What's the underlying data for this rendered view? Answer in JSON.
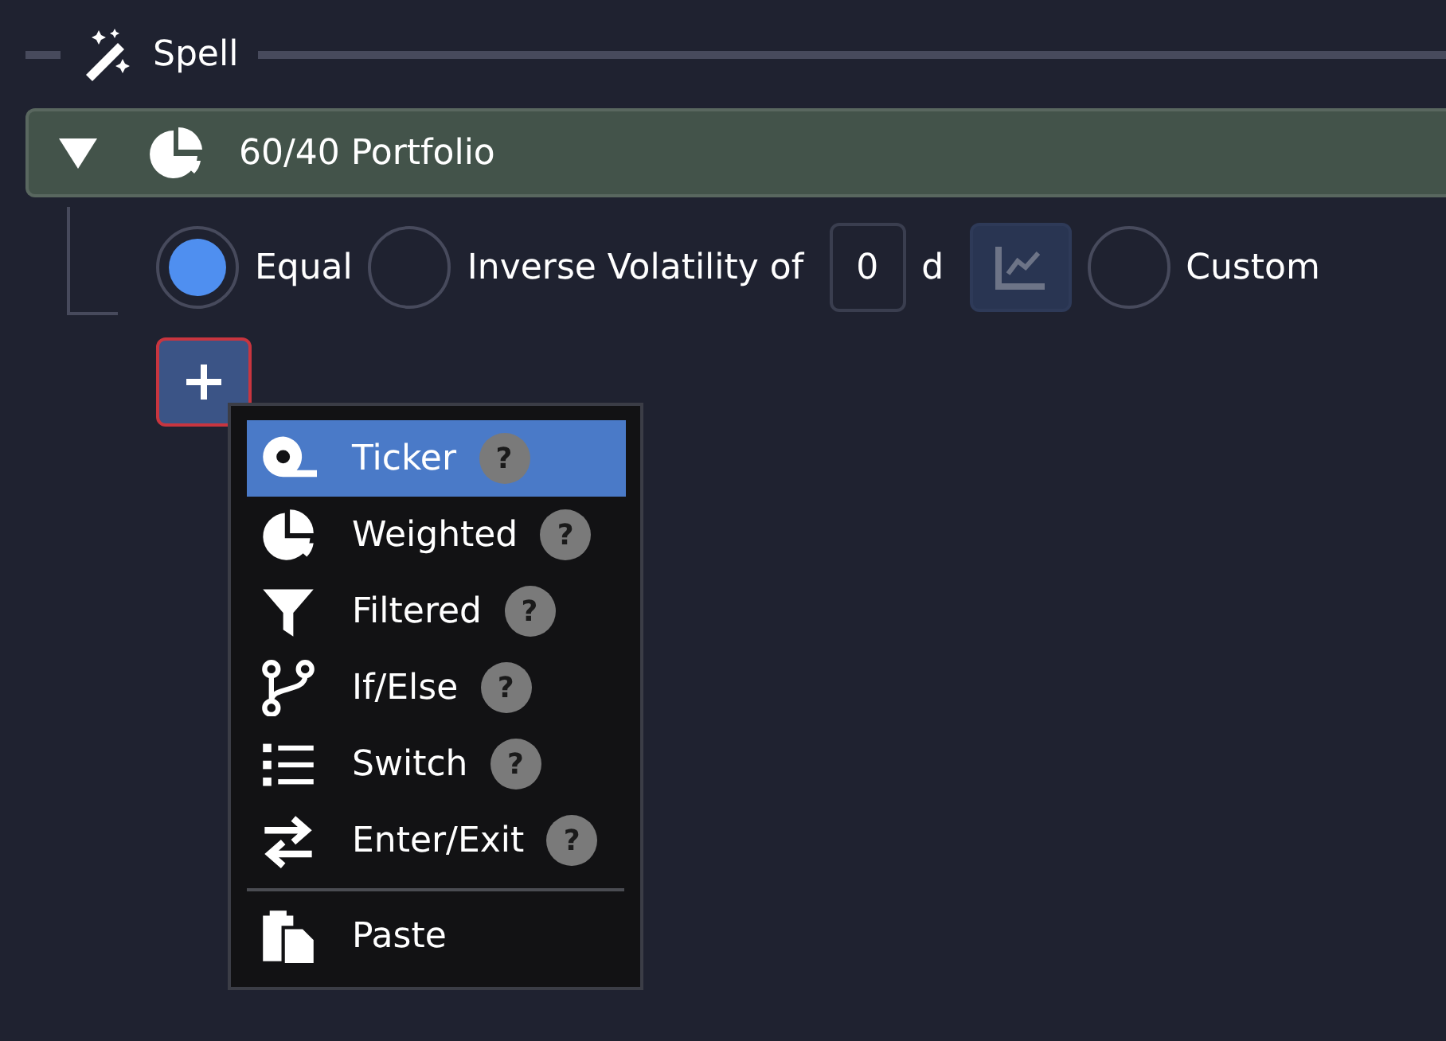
{
  "section": {
    "title": "Spell"
  },
  "node": {
    "title": "60/40 Portfolio",
    "expanded": true
  },
  "weighting": {
    "options": [
      {
        "kind": "equal",
        "label": "Equal",
        "selected": true
      },
      {
        "kind": "volatility",
        "label": "Inverse Volatility of",
        "value": "0",
        "unit": "d",
        "selected": false
      },
      {
        "kind": "custom",
        "label": "Custom",
        "selected": false
      }
    ]
  },
  "add_menu": {
    "items": [
      {
        "kind": "ticker",
        "label": "Ticker",
        "help": "?",
        "selected": true
      },
      {
        "kind": "weighted",
        "label": "Weighted",
        "help": "?",
        "selected": false
      },
      {
        "kind": "filtered",
        "label": "Filtered",
        "help": "?",
        "selected": false
      },
      {
        "kind": "ifelse",
        "label": "If/Else",
        "help": "?",
        "selected": false
      },
      {
        "kind": "switch",
        "label": "Switch",
        "help": "?",
        "selected": false
      },
      {
        "kind": "enterexit",
        "label": "Enter/Exit",
        "help": "?",
        "selected": false
      },
      {
        "kind": "paste",
        "label": "Paste",
        "selected": false
      }
    ]
  }
}
